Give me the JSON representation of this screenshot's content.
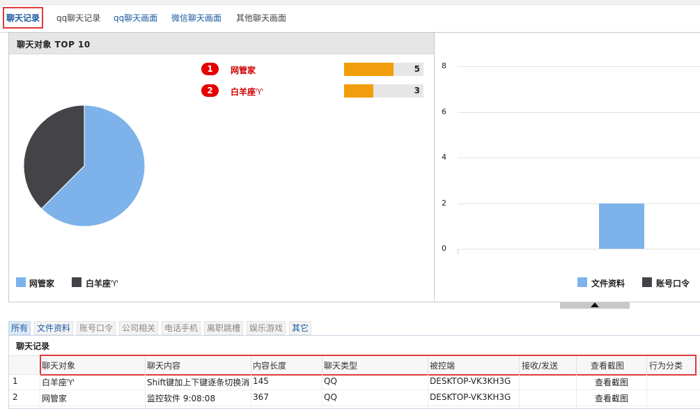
{
  "top_tabs": [
    {
      "label": "聊天记录",
      "active": true
    },
    {
      "label": "qq聊天记录"
    },
    {
      "label": "qq聊天画面"
    },
    {
      "label": "微信聊天画面"
    },
    {
      "label": "其他聊天画面"
    }
  ],
  "left_panel": {
    "title": "聊天对象 TOP 10",
    "ranking": [
      {
        "rank": "1",
        "name": "网管家",
        "value": "5",
        "fraction": 0.62
      },
      {
        "rank": "2",
        "name": "白羊座♈",
        "value": "3",
        "fraction": 0.37
      }
    ],
    "legend": [
      {
        "label": "网管家",
        "color": "#7db3ea"
      },
      {
        "label": "白羊座♈",
        "color": "#434348"
      }
    ]
  },
  "chart_data": [
    {
      "type": "pie",
      "labels": [
        "网管家",
        "白羊座♈"
      ],
      "values": [
        5,
        3
      ],
      "colors": [
        "#7db3ea",
        "#434348"
      ]
    },
    {
      "type": "bar",
      "categories": [
        "文件资料"
      ],
      "series": [
        {
          "name": "文件资料",
          "values": [
            2
          ],
          "color": "#7db3ea"
        },
        {
          "name": "账号口令",
          "values": [
            0
          ],
          "color": "#434348"
        }
      ],
      "yticks": [
        "0",
        "2",
        "4",
        "6",
        "8"
      ],
      "ylim": [
        0,
        8
      ],
      "legend": "bottom-right"
    }
  ],
  "category_tabs": [
    {
      "label": "所有",
      "style": "active"
    },
    {
      "label": "文件资料",
      "style": "blue"
    },
    {
      "label": "账号口令",
      "style": "grey"
    },
    {
      "label": "公司相关",
      "style": "grey"
    },
    {
      "label": "电话手机",
      "style": "grey"
    },
    {
      "label": "离职跳槽",
      "style": "grey"
    },
    {
      "label": "娱乐游戏",
      "style": "grey"
    },
    {
      "label": "其它",
      "style": "blue"
    }
  ],
  "table": {
    "title": "聊天记录",
    "columns": [
      "聊天对象",
      "聊天内容",
      "内容长度",
      "聊天类型",
      "被控端",
      "接收/发送",
      "查看截图",
      "行为分类"
    ],
    "rows": [
      [
        "1",
        "白羊座♈",
        "Shift键加上下键逐条切换消息",
        "145",
        "QQ",
        "DESKTOP-VK3KH3G",
        "",
        "查看截图",
        ""
      ],
      [
        "2",
        "网管家",
        "监控软件  9:08:08",
        "367",
        "QQ",
        "DESKTOP-VK3KH3G",
        "",
        "查看截图",
        ""
      ]
    ]
  }
}
